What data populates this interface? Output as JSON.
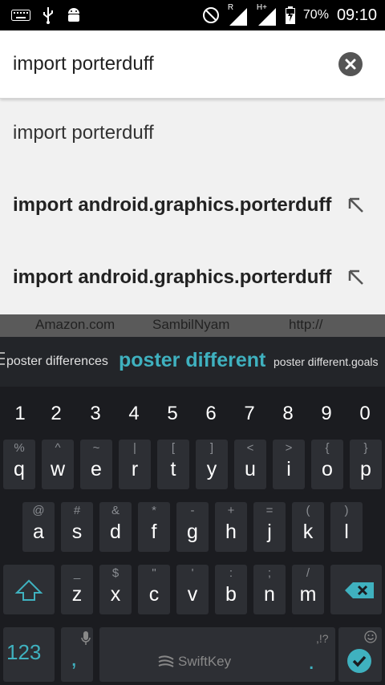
{
  "status_bar": {
    "battery": "70%",
    "time": "09:10",
    "roaming_indicator": "R",
    "network_type": "H+"
  },
  "search": {
    "query": "import porterduff"
  },
  "suggestions": [
    {
      "text": "import porterduff",
      "bold": false
    },
    {
      "text": "import android.graphics.porterduff",
      "bold": true
    },
    {
      "text": "import android.graphics.porterduff",
      "bold": true
    }
  ],
  "web_hints": [
    "Amazon.com",
    "SambilNyam",
    "http://"
  ],
  "prediction": {
    "left": "poster differences",
    "center": "poster different",
    "right": "poster different.goals"
  },
  "keyboard": {
    "numbers": [
      "1",
      "2",
      "3",
      "4",
      "5",
      "6",
      "7",
      "8",
      "9",
      "0"
    ],
    "row1": [
      {
        "main": "q",
        "alt": "%"
      },
      {
        "main": "w",
        "alt": "^"
      },
      {
        "main": "e",
        "alt": "~"
      },
      {
        "main": "r",
        "alt": "|"
      },
      {
        "main": "t",
        "alt": "["
      },
      {
        "main": "y",
        "alt": "]"
      },
      {
        "main": "u",
        "alt": "<"
      },
      {
        "main": "i",
        "alt": ">"
      },
      {
        "main": "o",
        "alt": "{"
      },
      {
        "main": "p",
        "alt": "}"
      }
    ],
    "row2": [
      {
        "main": "a",
        "alt": "@"
      },
      {
        "main": "s",
        "alt": "#"
      },
      {
        "main": "d",
        "alt": "&"
      },
      {
        "main": "f",
        "alt": "*"
      },
      {
        "main": "g",
        "alt": "-"
      },
      {
        "main": "h",
        "alt": "+"
      },
      {
        "main": "j",
        "alt": "="
      },
      {
        "main": "k",
        "alt": "("
      },
      {
        "main": "l",
        "alt": ")"
      }
    ],
    "row3": [
      {
        "main": "z",
        "alt": "_"
      },
      {
        "main": "x",
        "alt": "$"
      },
      {
        "main": "c",
        "alt": "\""
      },
      {
        "main": "v",
        "alt": "'"
      },
      {
        "main": "b",
        "alt": ":"
      },
      {
        "main": "n",
        "alt": ";"
      },
      {
        "main": "m",
        "alt": "/"
      }
    ],
    "symbols_label": "123",
    "comma": ",",
    "period": ".",
    "punct_hint": ",!?",
    "space_brand": "SwiftKey"
  },
  "colors": {
    "accent": "#3fb1bf"
  }
}
